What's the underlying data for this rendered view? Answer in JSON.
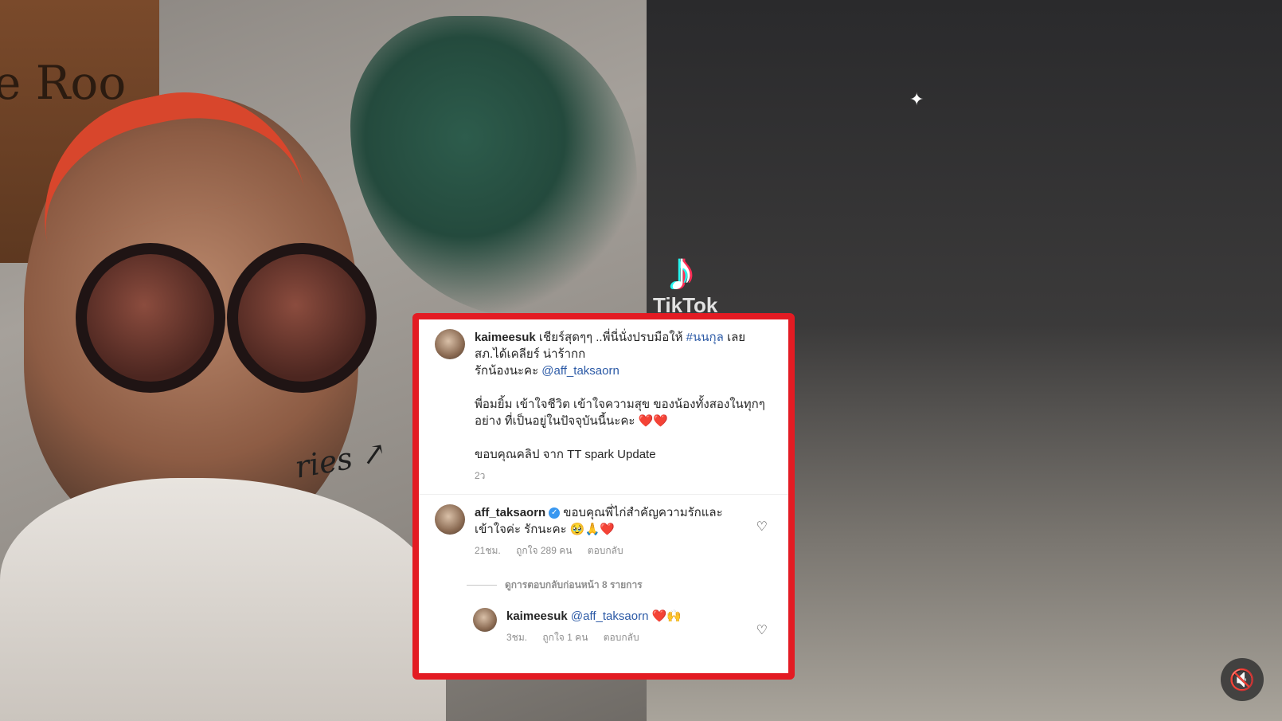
{
  "left_photo": {
    "sign_text": "e Roo",
    "wall_text": "ries ↗"
  },
  "right_photo": {
    "tiktok_logo_text": "TikTok"
  },
  "comment_panel": {
    "post": {
      "username": "kaimeesuk",
      "line1_text": " เชียร์สุดๆๆ ..พี่นี่นั่งปรบมือให้ ",
      "hashtag": "#นนกุล",
      "line1_tail": " เลยสภ.ได้เคลียร์ น่าร้ากก",
      "line2_prefix": "รักน้องนะคะ ",
      "line2_mention": "@aff_taksaorn",
      "line3_text": "พี่อมยิ้ม เข้าใจชีวิต เข้าใจความสุข ของน้องทั้งสองในทุกๆอย่าง ที่เป็นอยู่ในปัจจุบันนี้นะคะ ❤️❤️",
      "line4_text": "ขอบคุณคลิป จาก TT spark Update",
      "time": "2ว"
    },
    "reply": {
      "username": "aff_taksaorn",
      "verified_icon": "verified-badge",
      "text": "ขอบคุณพี่ไก่สำคัญความรักและเข้าใจค่ะ รักนะคะ 🥹🙏❤️",
      "time": "21ชม.",
      "likes": "ถูกใจ 289 คน",
      "reply_label": "ตอบกลับ",
      "heart_icon": "heart-outline-icon"
    },
    "view_more_label": "ดูการตอบกลับก่อนหน้า 8 รายการ",
    "nested_reply": {
      "username": "kaimeesuk",
      "mention": "@aff_taksaorn",
      "emoji": " ❤️🙌",
      "time": "3ชม.",
      "likes": "ถูกใจ 1 คน",
      "reply_label": "ตอบกลับ",
      "heart_icon": "heart-outline-icon"
    },
    "border_color": "#e31b23"
  },
  "mute_button_icon": "speaker-muted-icon"
}
